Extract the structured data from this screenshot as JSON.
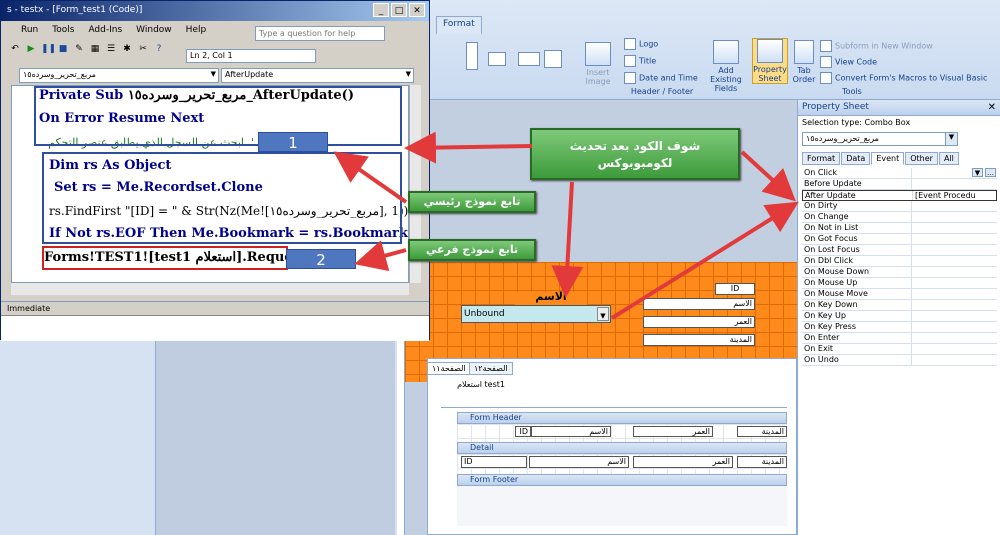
{
  "vba": {
    "title": "s - testx - [Form_test1 (Code)]",
    "menu": [
      "Run",
      "Tools",
      "Add-Ins",
      "Window",
      "Help"
    ],
    "help_placeholder": "Type a question for help",
    "position": "Ln 2, Col 1",
    "object_combo": "مربع_تحرير_وسرده١٥",
    "proc_combo": "AfterUpdate",
    "code": {
      "line1_kw": "Private Sub",
      "line1_rest": "مربع_تحرير_وسرده١٥_AfterUpdate()",
      "line2": "On Error Resume Next",
      "line3": "' .ابحث عن السجل الذي يطابق عنصر التحكم",
      "line4": "Dim rs As Object",
      "line5": "Set rs = Me.Recordset.Clone",
      "line6": "rs.FindFirst \"[ID] = \" & Str(Nz(Me![مربع_تحرير_وسرده١٥], 1))",
      "line7": "If Not rs.EOF Then Me.Bookmark = rs.Bookmark",
      "line8": "Forms!TEST1![test1 استعلام].Requery"
    },
    "immediate_title": "Immediate"
  },
  "annotations": {
    "tag1": "1",
    "tag2": "2",
    "callout_main": "تابع نموذج رئيسي",
    "callout_sub": "تابع نموذج فرعي",
    "callout_note": "شوف الكود بعد تحديث لكومبوبوكس"
  },
  "ribbon": {
    "tab_format": "Format",
    "logo": "Logo",
    "title": "Title",
    "date_time": "Date and Time",
    "group_header_footer": "Header / Footer",
    "insert_image": "Insert Image",
    "add_existing_fields": "Add Existing Fields",
    "property_sheet": "Property Sheet",
    "tab_order": "Tab Order",
    "subform_new_window": "Subform in New Window",
    "view_code": "View Code",
    "convert_macros": "Convert Form's Macros to Visual Basic",
    "group_tools": "Tools"
  },
  "property_sheet": {
    "title": "Property Sheet",
    "selection_type": "Selection type: Combo Box",
    "selected_control": "مربع_تحرير_وسرده١٥",
    "tabs": [
      "Format",
      "Data",
      "Event",
      "Other",
      "All"
    ],
    "active_tab": "Event",
    "rows": [
      {
        "k": "On Click",
        "v": ""
      },
      {
        "k": "Before Update",
        "v": ""
      },
      {
        "k": "After Update",
        "v": "[Event Procedu"
      },
      {
        "k": "On Dirty",
        "v": ""
      },
      {
        "k": "On Change",
        "v": ""
      },
      {
        "k": "On Not in List",
        "v": ""
      },
      {
        "k": "On Got Focus",
        "v": ""
      },
      {
        "k": "On Lost Focus",
        "v": ""
      },
      {
        "k": "On Dbl Click",
        "v": ""
      },
      {
        "k": "On Mouse Down",
        "v": ""
      },
      {
        "k": "On Mouse Up",
        "v": ""
      },
      {
        "k": "On Mouse Move",
        "v": ""
      },
      {
        "k": "On Key Down",
        "v": ""
      },
      {
        "k": "On Key Up",
        "v": ""
      },
      {
        "k": "On Key Press",
        "v": ""
      },
      {
        "k": "On Enter",
        "v": ""
      },
      {
        "k": "On Exit",
        "v": ""
      },
      {
        "k": "On Undo",
        "v": ""
      }
    ]
  },
  "form_design": {
    "label_name": "الاسم",
    "combo_value": "Unbound",
    "id_label": "ID",
    "field_name": "الاسم",
    "field_age": "العمر",
    "field_city": "المدينة",
    "subtab1": "الصفحة١١",
    "subtab2": "الصفحة١٢",
    "subform_name": "test1 استعلام",
    "form_header": "Form Header",
    "detail": "Detail",
    "form_footer": "Form Footer",
    "hdr_id": "ID",
    "hdr_name": "الاسم",
    "hdr_age": "العمر",
    "hdr_city": "المدينة"
  }
}
